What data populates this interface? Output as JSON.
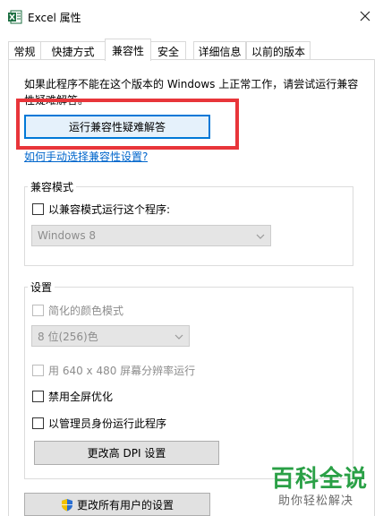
{
  "window": {
    "title": "Excel 属性"
  },
  "tabs": [
    {
      "label": "常规"
    },
    {
      "label": "快捷方式"
    },
    {
      "label": "兼容性"
    },
    {
      "label": "安全"
    },
    {
      "label": "详细信息"
    },
    {
      "label": "以前的版本"
    }
  ],
  "compat": {
    "description": "如果此程序不能在这个版本的 Windows 上正常工作，请尝试运行兼容性疑难解答。",
    "troubleshoot_button": "运行兼容性疑难解答",
    "manual_link": "如何手动选择兼容性设置?"
  },
  "compat_mode": {
    "group_label": "兼容模式",
    "checkbox_label": "以兼容模式运行这个程序:",
    "os_select_value": "Windows 8"
  },
  "settings": {
    "group_label": "设置",
    "reduced_color_label": "简化的颜色模式",
    "color_select_value": "8 位(256)色",
    "resolution_label": "用 640 x 480 屏幕分辨率运行",
    "disable_fullscreen_label": "禁用全屏优化",
    "run_as_admin_label": "以管理员身份运行此程序",
    "dpi_button": "更改高 DPI 设置"
  },
  "footer": {
    "all_users_button": "更改所有用户的设置"
  },
  "watermark": {
    "brand": "百科全说",
    "tagline": "助你轻松解决"
  },
  "colors": {
    "highlight": "#e8353a",
    "link": "#0066cc",
    "watermark_green": "#2aa046"
  }
}
